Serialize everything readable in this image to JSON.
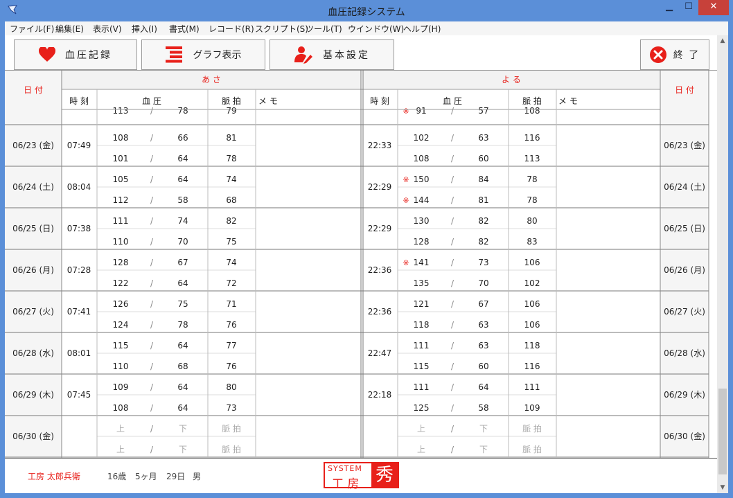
{
  "window": {
    "title": "血圧記録システム",
    "minimize": "▁",
    "maximize": "☐",
    "close": "✕"
  },
  "menu": [
    "ファイル(F)",
    "編集(E)",
    "表示(V)",
    "挿入(I)",
    "書式(M)",
    "レコード(R)",
    "スクリプト(S)",
    "ツール(T)",
    "ウインドウ(W)",
    "ヘルプ(H)"
  ],
  "toolbar": {
    "record": "血圧記録",
    "graph": "グラフ表示",
    "settings": "基本設定",
    "exit": "終 了"
  },
  "header": {
    "date": "日 付",
    "morning": "あ さ",
    "night": "よ る",
    "time": "時 刻",
    "bp": "血 圧",
    "pulse": "脈 拍",
    "memo": "メ モ"
  },
  "placeholder": {
    "upper": "上",
    "lower": "下",
    "pulse": "脈 拍"
  },
  "sep": "/",
  "mark": "※",
  "partial_top": {
    "am": {
      "s": "113",
      "d": "78",
      "p": "79"
    },
    "pm": {
      "s": "91",
      "d": "57",
      "p": "108",
      "mark": true
    }
  },
  "rows": [
    {
      "date": "06/23 (金)",
      "am_time": "07:49",
      "am": [
        [
          "108",
          "66",
          "81"
        ],
        [
          "101",
          "64",
          "78"
        ]
      ],
      "pm_time": "22:33",
      "pm": [
        [
          "102",
          "63",
          "116"
        ],
        [
          "108",
          "60",
          "113"
        ]
      ],
      "pm_mark": [
        false,
        false
      ]
    },
    {
      "date": "06/24 (土)",
      "am_time": "08:04",
      "am": [
        [
          "105",
          "64",
          "74"
        ],
        [
          "112",
          "58",
          "68"
        ]
      ],
      "pm_time": "22:29",
      "pm": [
        [
          "150",
          "84",
          "78"
        ],
        [
          "144",
          "81",
          "78"
        ]
      ],
      "pm_mark": [
        true,
        true
      ]
    },
    {
      "date": "06/25 (日)",
      "am_time": "07:38",
      "am": [
        [
          "111",
          "74",
          "82"
        ],
        [
          "110",
          "70",
          "75"
        ]
      ],
      "pm_time": "22:29",
      "pm": [
        [
          "130",
          "82",
          "80"
        ],
        [
          "128",
          "82",
          "83"
        ]
      ],
      "pm_mark": [
        false,
        false
      ]
    },
    {
      "date": "06/26 (月)",
      "am_time": "07:28",
      "am": [
        [
          "128",
          "67",
          "74"
        ],
        [
          "122",
          "64",
          "72"
        ]
      ],
      "pm_time": "22:36",
      "pm": [
        [
          "141",
          "73",
          "106"
        ],
        [
          "135",
          "70",
          "102"
        ]
      ],
      "pm_mark": [
        true,
        false
      ]
    },
    {
      "date": "06/27 (火)",
      "am_time": "07:41",
      "am": [
        [
          "126",
          "75",
          "71"
        ],
        [
          "124",
          "78",
          "76"
        ]
      ],
      "pm_time": "22:36",
      "pm": [
        [
          "121",
          "67",
          "106"
        ],
        [
          "118",
          "63",
          "106"
        ]
      ],
      "pm_mark": [
        false,
        false
      ]
    },
    {
      "date": "06/28 (水)",
      "am_time": "08:01",
      "am": [
        [
          "115",
          "64",
          "77"
        ],
        [
          "110",
          "68",
          "76"
        ]
      ],
      "pm_time": "22:47",
      "pm": [
        [
          "111",
          "63",
          "118"
        ],
        [
          "115",
          "60",
          "116"
        ]
      ],
      "pm_mark": [
        false,
        false
      ]
    },
    {
      "date": "06/29 (木)",
      "am_time": "07:45",
      "am": [
        [
          "109",
          "64",
          "80"
        ],
        [
          "108",
          "64",
          "73"
        ]
      ],
      "pm_time": "22:18",
      "pm": [
        [
          "111",
          "64",
          "111"
        ],
        [
          "125",
          "58",
          "109"
        ]
      ],
      "pm_mark": [
        false,
        false
      ]
    },
    {
      "date": "06/30 (金)",
      "am_time": "",
      "am": [],
      "pm_time": "",
      "pm": [],
      "pm_mark": [
        false,
        false
      ],
      "empty": true
    }
  ],
  "footer": {
    "name": "工房 太郎兵衛",
    "age_years": "16歳",
    "age_months": "5ヶ月",
    "age_days": "29日",
    "sex": "男",
    "logo_system": "SYSTEM",
    "logo_kobo": "工 房",
    "logo_hide": "秀"
  },
  "colors": {
    "accent_red": "#e8201a",
    "chrome_blue": "#5b8fd8"
  }
}
